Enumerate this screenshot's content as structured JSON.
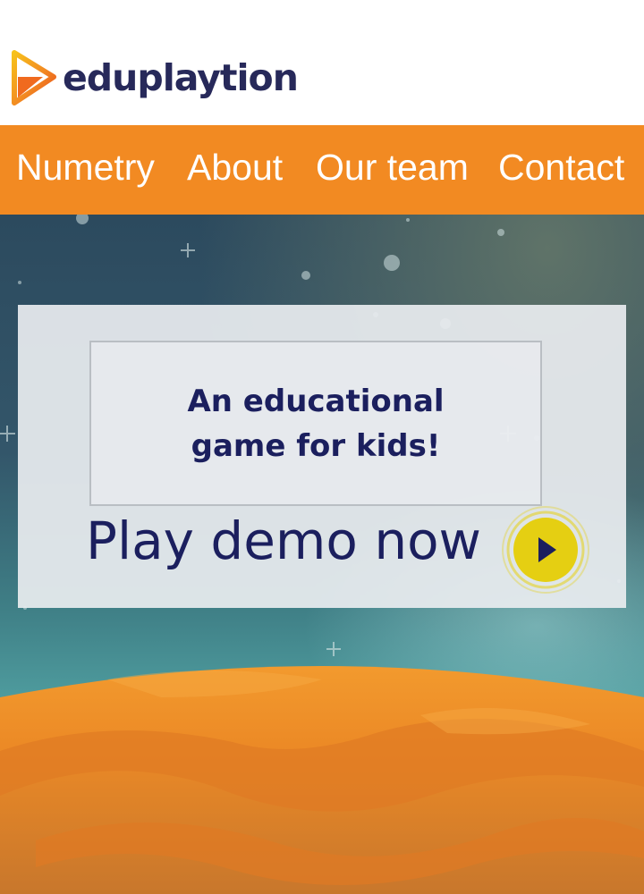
{
  "brand": {
    "name": "eduplaytion",
    "logo_icon": "play-triangle-logo",
    "colors": {
      "text": "#27295a",
      "orange": "#f28a22",
      "yellow": "#f5c518"
    }
  },
  "nav": {
    "items": [
      {
        "label": "Numetry"
      },
      {
        "label": "About"
      },
      {
        "label": "Our team"
      },
      {
        "label": "Contact"
      }
    ],
    "background": "#f28a22"
  },
  "hero": {
    "tagline_line1": "An educational",
    "tagline_line2": "game for kids!",
    "cta_label": "Play demo now",
    "cta_icon": "play-icon",
    "colors": {
      "text": "#1b1f5e",
      "button": "#e5cf12"
    }
  }
}
